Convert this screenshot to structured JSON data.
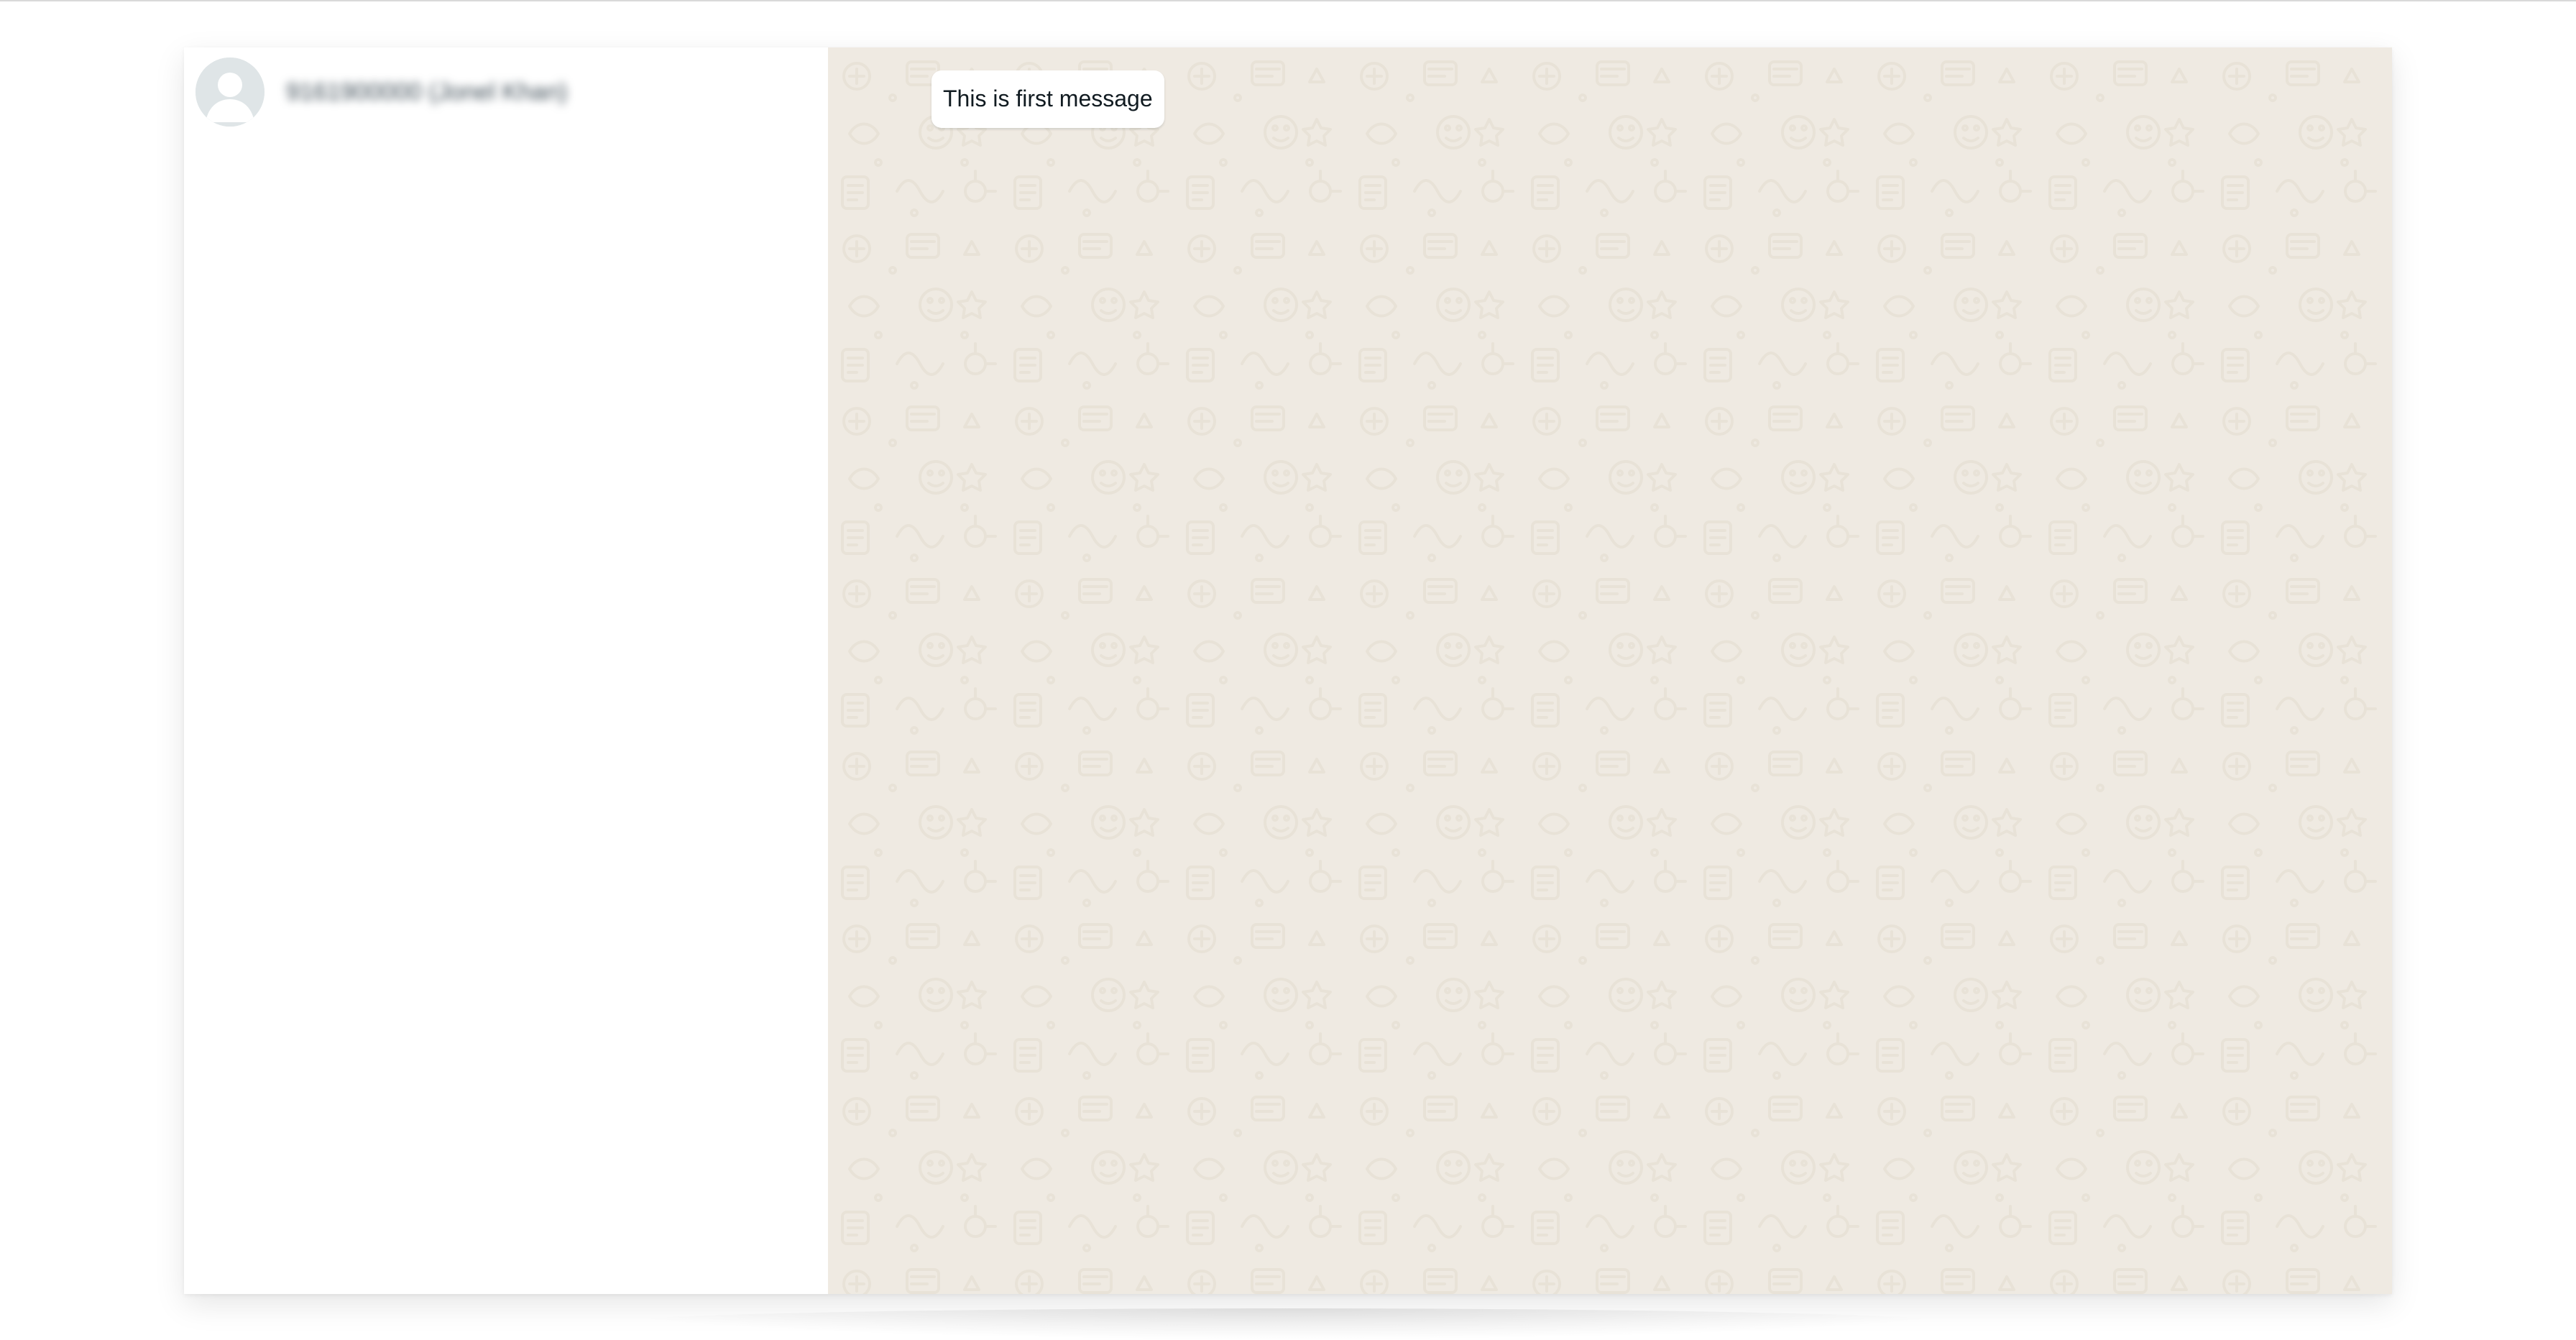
{
  "contact": {
    "name": "9161900000 (Jonel Khan)",
    "avatar_icon": "default-user-avatar-icon"
  },
  "chat": {
    "messages": [
      {
        "text": "This is first message",
        "direction": "incoming"
      }
    ],
    "background_color": "#efeae2",
    "pattern_color": "#e4ddd2"
  }
}
